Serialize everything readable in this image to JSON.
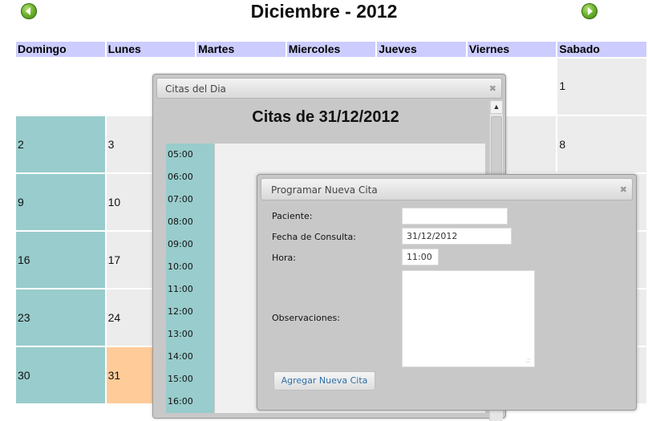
{
  "header": {
    "title": "Diciembre - 2012",
    "prev_icon": "arrow-left-icon",
    "next_icon": "arrow-right-icon"
  },
  "calendar": {
    "weekdays": [
      "Domingo",
      "Lunes",
      "Martes",
      "Miercoles",
      "Jueves",
      "Viernes",
      "Sabado"
    ],
    "weeks": [
      [
        "",
        "",
        "",
        "",
        "",
        "",
        "1"
      ],
      [
        "2",
        "3",
        "",
        "",
        "",
        "",
        "8"
      ],
      [
        "9",
        "10",
        "",
        "",
        "",
        "",
        ""
      ],
      [
        "16",
        "17",
        "",
        "",
        "",
        "",
        ""
      ],
      [
        "23",
        "24",
        "",
        "",
        "",
        "",
        ""
      ],
      [
        "30",
        "31",
        "",
        "",
        "",
        "",
        ""
      ]
    ],
    "selected_day": "31",
    "colors": {
      "header": "#ccccff",
      "sunday": "#99cccc",
      "selected": "#ffcc99",
      "day": "#ececec"
    }
  },
  "citas_dialog": {
    "title": "Citas del Dia",
    "close_icon": "close-icon",
    "heading": "Citas de 31/12/2012",
    "slots": [
      "05:00",
      "06:00",
      "07:00",
      "08:00",
      "09:00",
      "10:00",
      "11:00",
      "12:00",
      "13:00",
      "14:00",
      "15:00",
      "16:00"
    ]
  },
  "nueva_cita_dialog": {
    "title": "Programar Nueva Cita",
    "close_icon": "close-icon",
    "fields": {
      "paciente_label": "Paciente:",
      "paciente_value": "",
      "fecha_label": "Fecha de Consulta:",
      "fecha_value": "31/12/2012",
      "hora_label": "Hora:",
      "hora_value": "11:00",
      "observaciones_label": "Observaciones:",
      "observaciones_value": ""
    },
    "submit_label": "Agregar Nueva Cita"
  }
}
